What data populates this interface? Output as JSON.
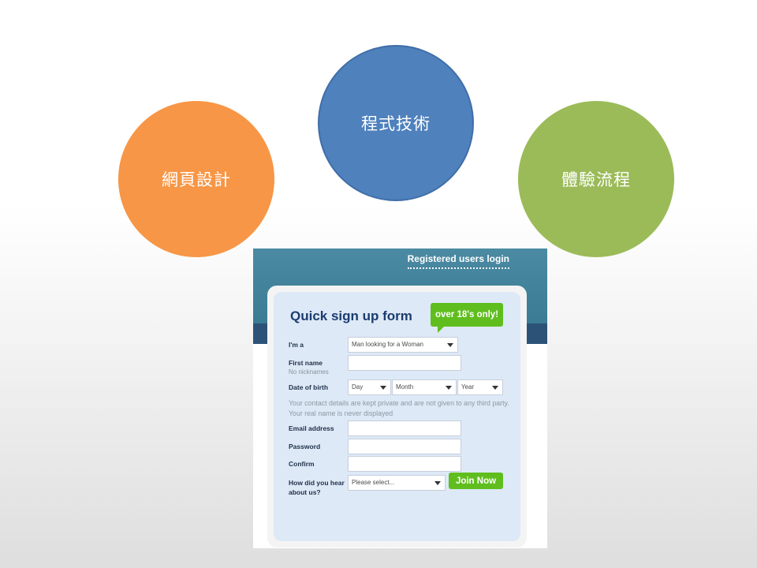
{
  "circles": [
    {
      "label": "網頁設計",
      "color": "#f79646"
    },
    {
      "label": "程式技術",
      "color": "#4f81bd"
    },
    {
      "label": "體驗流程",
      "color": "#9bbb59"
    }
  ],
  "signup": {
    "login_link": "Registered users login",
    "title": "Quick sign up form",
    "badge": "over 18's only!",
    "iam_label": "I'm a",
    "iam_value": "Man looking for a Woman",
    "firstname_label": "First name",
    "firstname_hint": "No nicknames",
    "dob_label": "Date of birth",
    "dob_day": "Day",
    "dob_month": "Month",
    "dob_year": "Year",
    "notice": "Your contact details are kept private and are not given to any third party. Your real name is never displayed",
    "email_label": "Email address",
    "password_label": "Password",
    "confirm_label": "Confirm",
    "hear_label": "How did you hear about us?",
    "hear_value": "Please select...",
    "join_label": "Join Now",
    "accent_color": "#5fbe1e"
  }
}
